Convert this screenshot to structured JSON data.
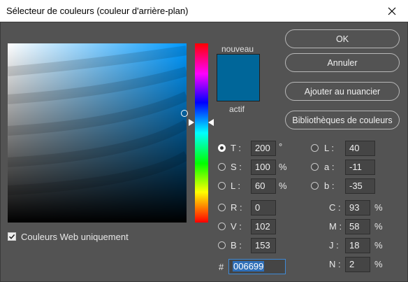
{
  "window": {
    "title": "Sélecteur de couleurs (couleur d'arrière-plan)",
    "close_icon": "close-icon"
  },
  "swatches": {
    "new_label": "nouveau",
    "current_label": "actif",
    "new_color": "#006699",
    "current_color": "#006699"
  },
  "buttons": {
    "ok": "OK",
    "cancel": "Annuler",
    "add_to_swatches": "Ajouter au nuancier",
    "color_libraries": "Bibliothèques de couleurs"
  },
  "hsb": {
    "h": {
      "label": "T :",
      "value": "200",
      "unit": "°",
      "selected": true
    },
    "s": {
      "label": "S :",
      "value": "100",
      "unit": "%"
    },
    "b": {
      "label": "L :",
      "value": "60",
      "unit": "%"
    }
  },
  "rgb": {
    "r": {
      "label": "R :",
      "value": "0"
    },
    "g": {
      "label": "V :",
      "value": "102"
    },
    "b": {
      "label": "B :",
      "value": "153"
    }
  },
  "lab": {
    "l": {
      "label": "L :",
      "value": "40"
    },
    "a": {
      "label": "a :",
      "value": "-11"
    },
    "b": {
      "label": "b :",
      "value": "-35"
    }
  },
  "cmyk": {
    "c": {
      "label": "C :",
      "value": "93",
      "unit": "%"
    },
    "m": {
      "label": "M :",
      "value": "58",
      "unit": "%"
    },
    "y": {
      "label": "J :",
      "value": "18",
      "unit": "%"
    },
    "k": {
      "label": "N :",
      "value": "2",
      "unit": "%"
    }
  },
  "hex": {
    "label": "#",
    "value": "006699"
  },
  "web_colors_only": {
    "label": "Couleurs Web uniquement",
    "checked": true
  },
  "colors": {
    "background": "#535353",
    "hue_fill": "#0099ff",
    "accent": "#2f6fb8"
  }
}
